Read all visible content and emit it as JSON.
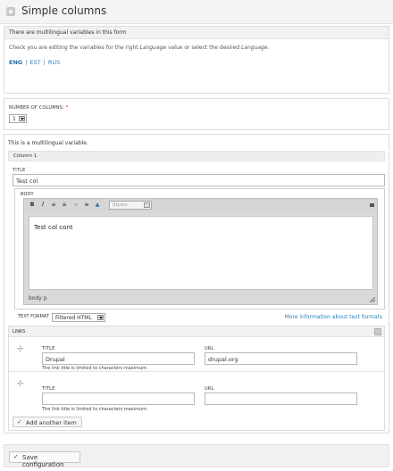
{
  "header": {
    "title": "Simple columns"
  },
  "notice": {
    "bar_text": "There are multilingual variables in this form",
    "desc_before": "Check you are editing the variables for the right ",
    "desc_lang1": "Language",
    "desc_middle": " value or select the desired ",
    "desc_lang2": "Language",
    "desc_end": ".",
    "languages": [
      "ENG",
      "EST",
      "RUS"
    ],
    "separator": "|"
  },
  "columns": {
    "label": "NUMBER OF COLUMNS:",
    "required_mark": "*",
    "value": "1"
  },
  "main": {
    "ml_note": "This is a multilingual variable.",
    "column_header": "Column 1",
    "title_label": "TITLE",
    "title_value": "Test col",
    "body_label": "BODY",
    "editor": {
      "styles_label": "Styles",
      "content": "Test col cont",
      "path": "body  p"
    },
    "format": {
      "label": "TEXT FORMAT",
      "value": "Filtered HTML",
      "more_link": "More information about text formats"
    },
    "links": {
      "label": "LINKS",
      "rows": [
        {
          "title_label": "TITLE",
          "title_value": "Drupal",
          "url_label": "URL",
          "url_value": "drupal.org",
          "hint": "The link title is limited to characters maximum."
        },
        {
          "title_label": "TITLE",
          "title_value": "",
          "url_label": "URL",
          "url_value": "",
          "hint": "The link title is limited to characters maximum."
        }
      ],
      "add_button": "Add another item"
    }
  },
  "footer": {
    "save_button": "Save configuration"
  },
  "icons": {
    "toolbar": [
      "bold-icon",
      "italic-icon",
      "bullet-list-icon",
      "numbered-list-icon",
      "link-icon",
      "unlink-icon",
      "image-icon"
    ],
    "drag": "drag-handle-icon",
    "check": "check-icon"
  }
}
